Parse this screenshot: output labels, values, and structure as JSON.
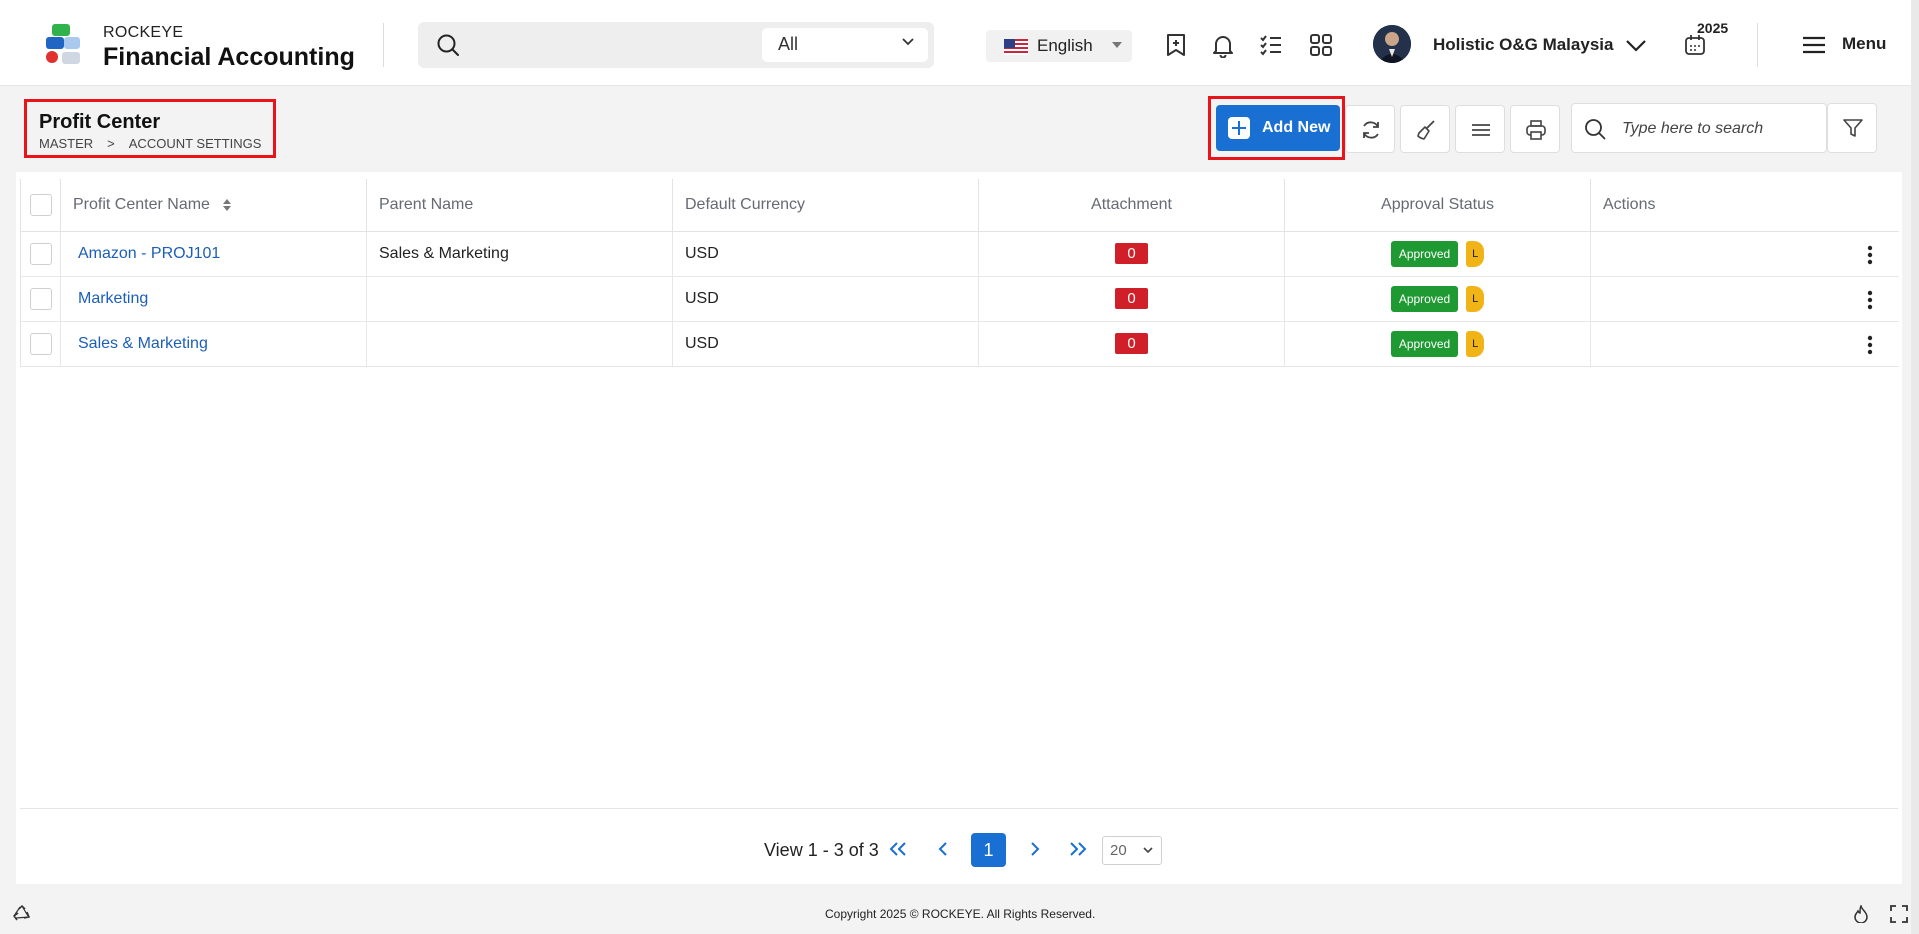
{
  "app": {
    "brand_small": "ROCKEYE",
    "brand_big": "Financial Accounting"
  },
  "header": {
    "search_placeholder": "",
    "scope_selected": "All",
    "language": "English",
    "company": "Holistic O&G Malaysia",
    "year": "2025",
    "menu_label": "Menu"
  },
  "page": {
    "title": "Profit Center",
    "breadcrumb": [
      "MASTER",
      ">",
      "ACCOUNT SETTINGS"
    ]
  },
  "toolbar": {
    "add_label": "Add New",
    "search_placeholder": "Type here to search"
  },
  "table": {
    "columns": [
      "Profit Center Name",
      "Parent Name",
      "Default Currency",
      "Attachment",
      "Approval Status",
      "Actions"
    ],
    "rows": [
      {
        "name": "Amazon - PROJ101",
        "parent": "Sales & Marketing",
        "currency": "USD",
        "attachment": "0",
        "status": "Approved",
        "level": "L"
      },
      {
        "name": "Marketing",
        "parent": "",
        "currency": "USD",
        "attachment": "0",
        "status": "Approved",
        "level": "L"
      },
      {
        "name": "Sales & Marketing",
        "parent": "",
        "currency": "USD",
        "attachment": "0",
        "status": "Approved",
        "level": "L"
      }
    ]
  },
  "pagination": {
    "info": "View 1 - 3 of 3",
    "current_page": "1",
    "page_size": "20"
  },
  "footer": {
    "copyright": "Copyright 2025 © ROCKEYE. All Rights Reserved."
  },
  "colors": {
    "primary": "#1a6fd2",
    "approved": "#1f9a33",
    "attachment_badge": "#d11f29",
    "level_badge": "#f0b416",
    "highlight_outline": "#e8141a",
    "link": "#1c5fb8"
  }
}
